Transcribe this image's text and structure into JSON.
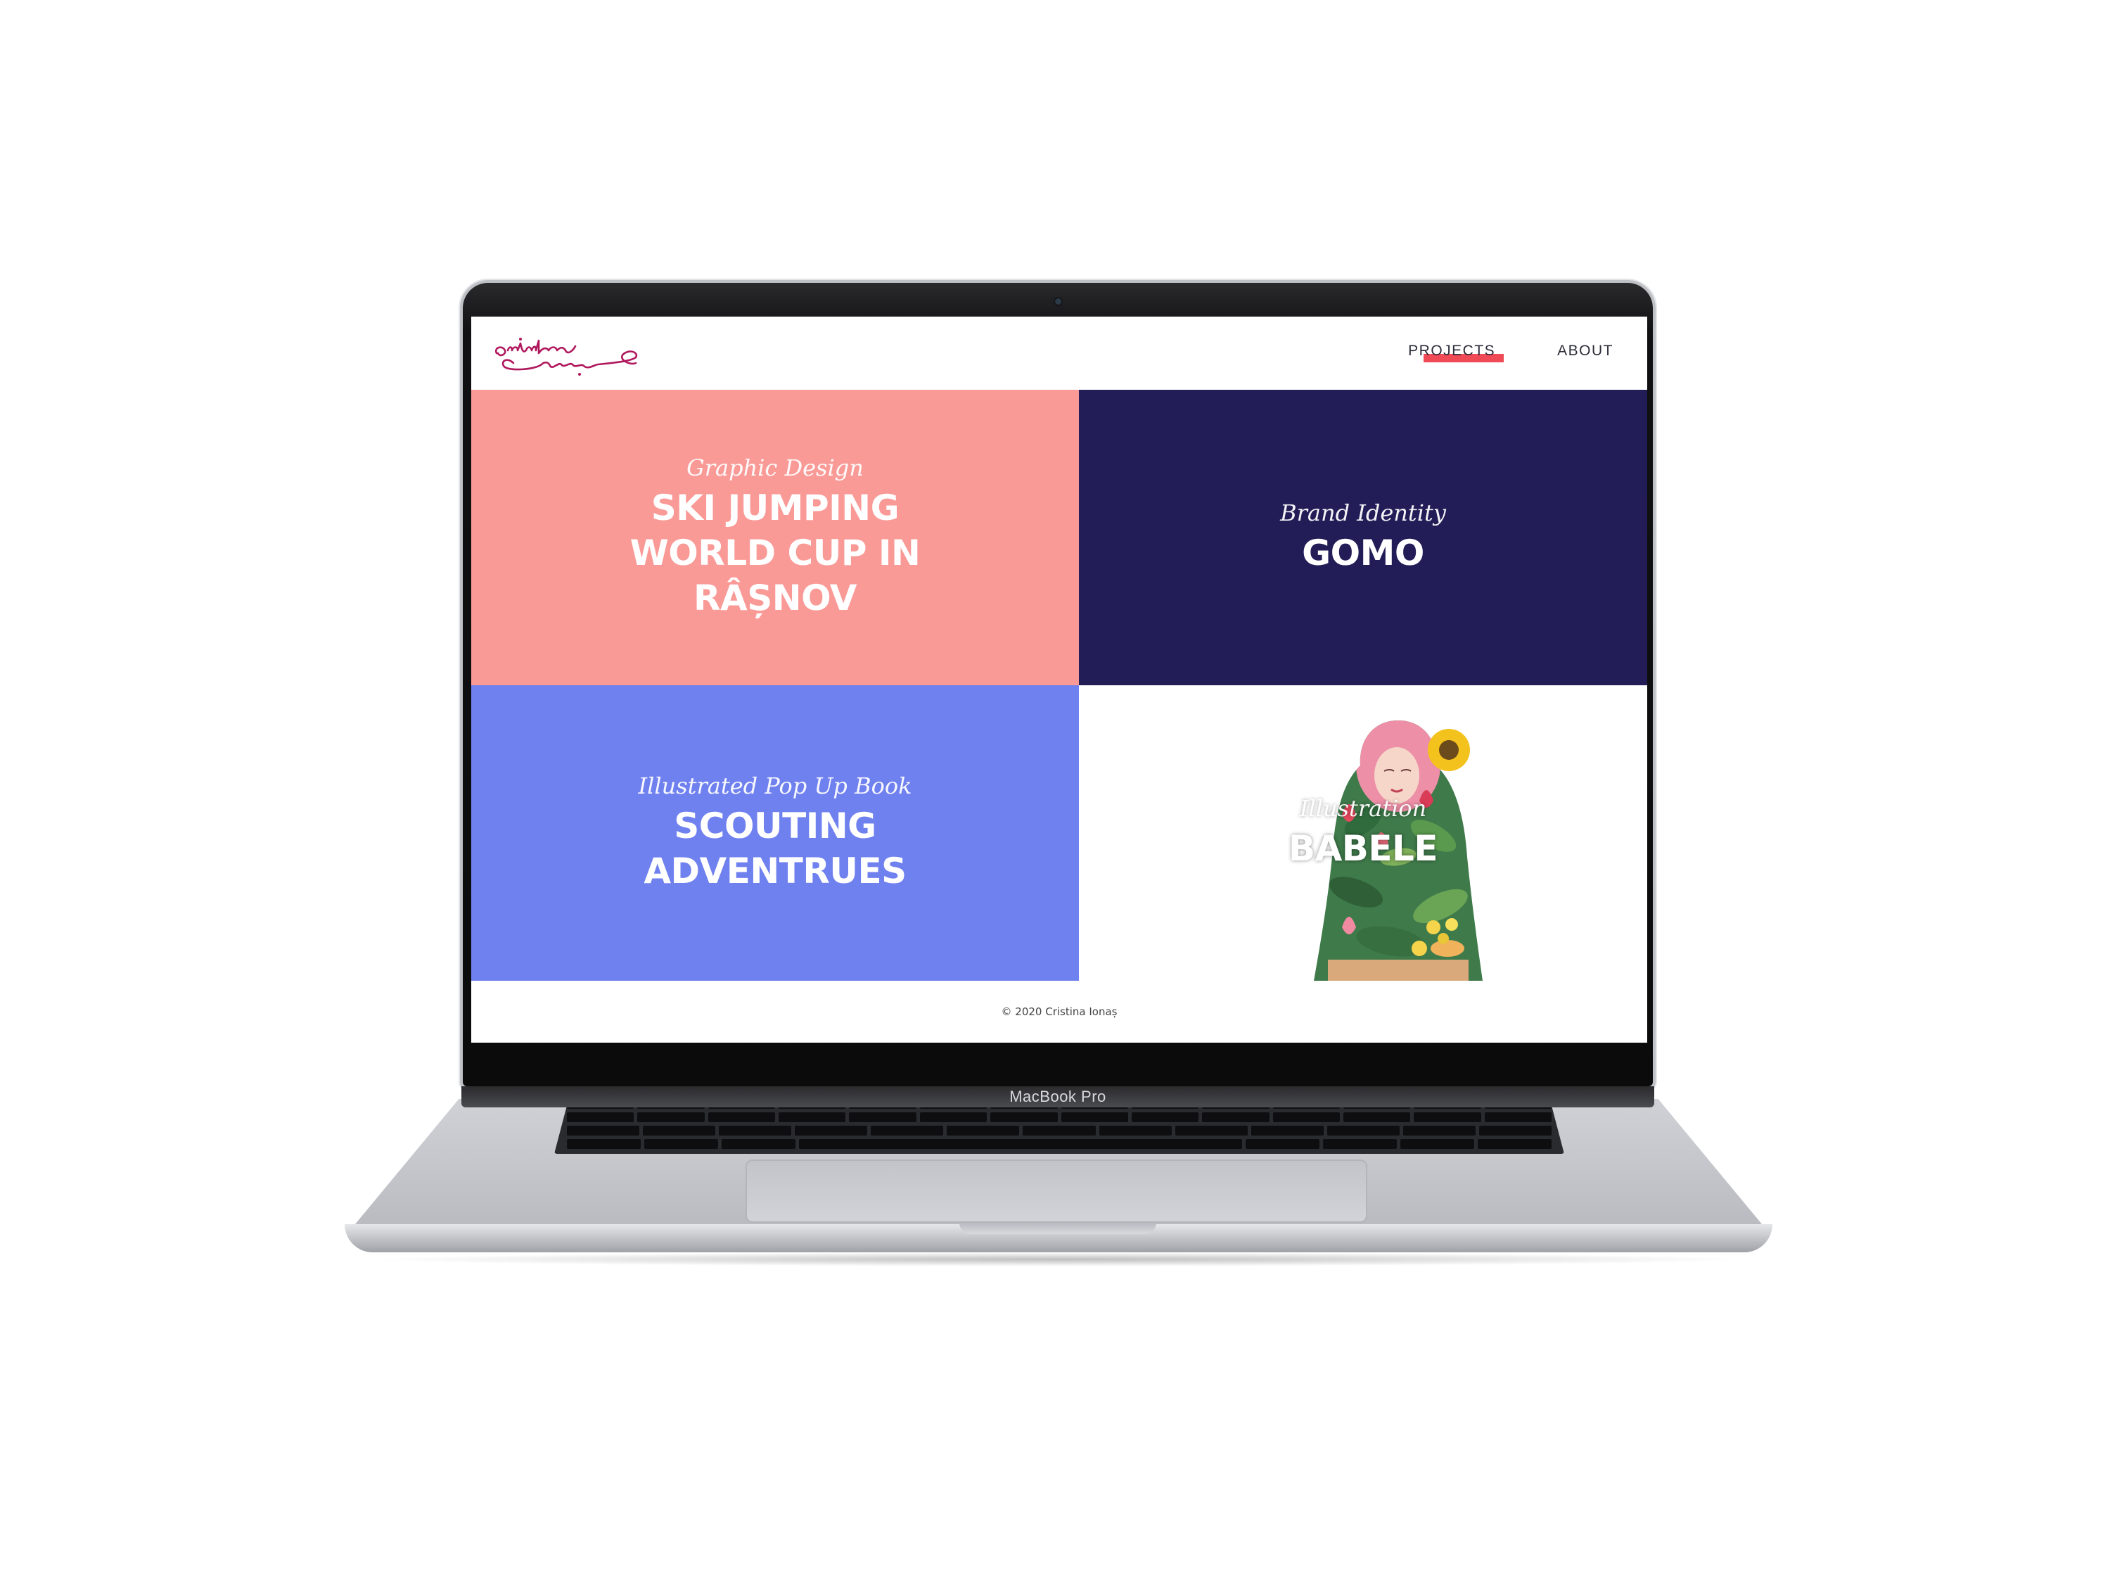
{
  "device": {
    "model_label": "MacBook Pro"
  },
  "site": {
    "logo_text": "cristina ionaș",
    "nav": [
      {
        "label": "PROJECTS",
        "active": true
      },
      {
        "label": "ABOUT",
        "active": false
      }
    ],
    "accent_color": "#ef4a55",
    "projects": [
      {
        "category": "Graphic Design",
        "title": "SKI JUMPING\nWORLD CUP IN\nRÂȘNOV",
        "color": "#f99a97"
      },
      {
        "category": "Brand Identity",
        "title": "GOMO",
        "color": "#221d57"
      },
      {
        "category": "Illustrated Pop Up Book",
        "title": "SCOUTING\nADVENTRUES",
        "color": "#6f80ef"
      },
      {
        "category": "Illustration",
        "title": "BABELE",
        "color": "#ffffff",
        "image": "floral-woman-illustration"
      }
    ],
    "footer_text": "© 2020 Cristina Ionaș"
  }
}
